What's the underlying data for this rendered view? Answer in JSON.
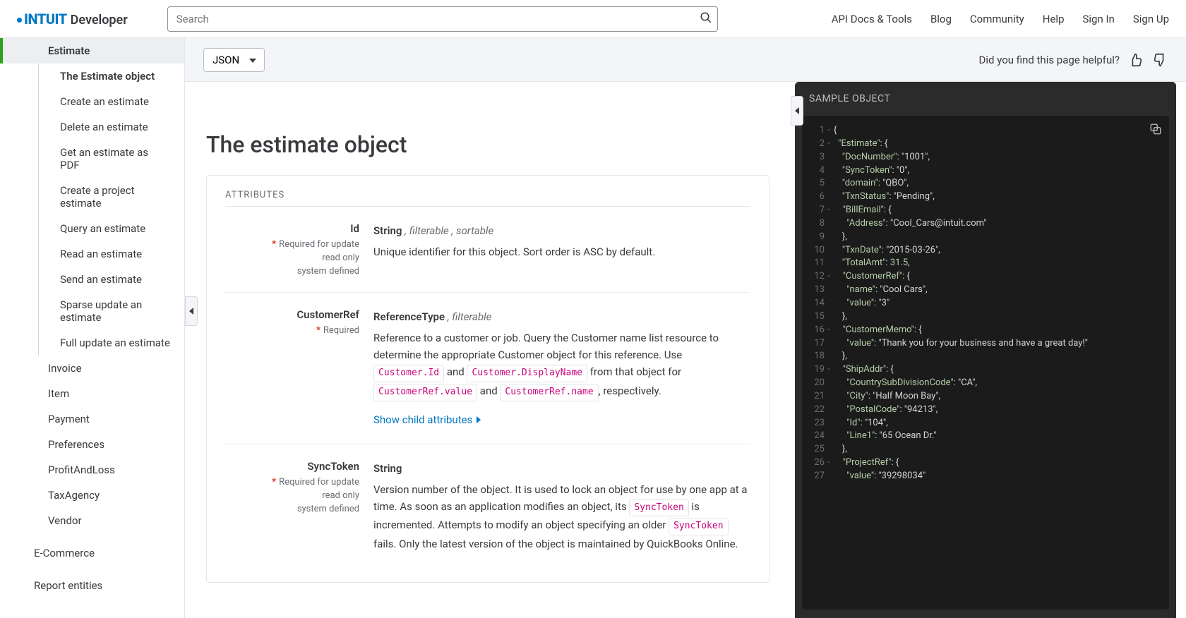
{
  "logo": {
    "brand": "INTUIT",
    "product": "Developer"
  },
  "search": {
    "placeholder": "Search"
  },
  "topnav": [
    "API Docs & Tools",
    "Blog",
    "Community",
    "Help",
    "Sign In",
    "Sign Up"
  ],
  "sidebar": {
    "parent": "Estimate",
    "children": [
      "The Estimate object",
      "Create an estimate",
      "Delete an estimate",
      "Get an estimate as PDF",
      "Create a project estimate",
      "Query an estimate",
      "Read an estimate",
      "Send an estimate",
      "Sparse update an estimate",
      "Full update an estimate"
    ],
    "rest": [
      "Invoice",
      "Item",
      "Payment",
      "Preferences",
      "ProfitAndLoss",
      "TaxAgency",
      "Vendor"
    ],
    "groups": [
      "E-Commerce",
      "Report entities"
    ]
  },
  "toolbar": {
    "format": "JSON",
    "helpful": "Did you find this page helpful?"
  },
  "page": {
    "title": "The estimate object",
    "attrHeader": "ATTRIBUTES"
  },
  "attrs": [
    {
      "name": "Id",
      "type": "String",
      "mods": ", filterable , sortable",
      "req": "Required for update",
      "meta1": "read only",
      "meta2": "system defined",
      "desc": "Unique identifier for this object. Sort order is ASC by default."
    },
    {
      "name": "CustomerRef",
      "type": "ReferenceType",
      "mods": ", filterable",
      "req": "Required",
      "meta1": "",
      "meta2": "",
      "desc_a": "Reference to a customer or job. Query the Customer name list resource to determine the appropriate Customer object for this reference. Use ",
      "pill1": "Customer.Id",
      "join1": " and ",
      "pill2": "Customer.DisplayName",
      "desc_b": " from that object for ",
      "pill3": "CustomerRef.value",
      "join2": " and ",
      "pill4": "CustomerRef.name",
      "desc_c": ", respectively.",
      "show": "Show child attributes"
    },
    {
      "name": "SyncToken",
      "type": "String",
      "mods": "",
      "req": "Required for update",
      "meta1": "read only",
      "meta2": "system defined",
      "desc_a": "Version number of the object. It is used to lock an object for use by one app at a time. As soon as an application modifies an object, its ",
      "pill1": "SyncToken",
      "desc_b": " is incremented. Attempts to modify an object specifying an older ",
      "pill2": "SyncToken",
      "desc_c": " fails. Only the latest version of the object is maintained by QuickBooks Online."
    }
  ],
  "sample": {
    "title": "SAMPLE OBJECT"
  },
  "code": [
    {
      "n": 1,
      "fold": "-",
      "txt": [
        [
          "pun",
          "{"
        ]
      ]
    },
    {
      "n": 2,
      "fold": "-",
      "txt": [
        [
          "pun",
          "  "
        ],
        [
          "key",
          "\"Estimate\""
        ],
        [
          "pun",
          ": {"
        ]
      ]
    },
    {
      "n": 3,
      "txt": [
        [
          "pun",
          "    "
        ],
        [
          "key",
          "\"DocNumber\""
        ],
        [
          "pun",
          ": "
        ],
        [
          "str",
          "\"1001\""
        ],
        [
          "pun",
          ","
        ]
      ]
    },
    {
      "n": 4,
      "txt": [
        [
          "pun",
          "    "
        ],
        [
          "key",
          "\"SyncToken\""
        ],
        [
          "pun",
          ": "
        ],
        [
          "str",
          "\"0\""
        ],
        [
          "pun",
          ","
        ]
      ]
    },
    {
      "n": 5,
      "txt": [
        [
          "pun",
          "    "
        ],
        [
          "key",
          "\"domain\""
        ],
        [
          "pun",
          ": "
        ],
        [
          "str",
          "\"QBO\""
        ],
        [
          "pun",
          ","
        ]
      ]
    },
    {
      "n": 6,
      "txt": [
        [
          "pun",
          "    "
        ],
        [
          "key",
          "\"TxnStatus\""
        ],
        [
          "pun",
          ": "
        ],
        [
          "str",
          "\"Pending\""
        ],
        [
          "pun",
          ","
        ]
      ]
    },
    {
      "n": 7,
      "fold": "-",
      "txt": [
        [
          "pun",
          "    "
        ],
        [
          "key",
          "\"BillEmail\""
        ],
        [
          "pun",
          ": {"
        ]
      ]
    },
    {
      "n": 8,
      "txt": [
        [
          "pun",
          "      "
        ],
        [
          "key",
          "\"Address\""
        ],
        [
          "pun",
          ": "
        ],
        [
          "str",
          "\"Cool_Cars@intuit.com\""
        ]
      ]
    },
    {
      "n": 9,
      "txt": [
        [
          "pun",
          "    },"
        ]
      ]
    },
    {
      "n": 10,
      "txt": [
        [
          "pun",
          "    "
        ],
        [
          "key",
          "\"TxnDate\""
        ],
        [
          "pun",
          ": "
        ],
        [
          "str",
          "\"2015-03-26\""
        ],
        [
          "pun",
          ","
        ]
      ]
    },
    {
      "n": 11,
      "txt": [
        [
          "pun",
          "    "
        ],
        [
          "key",
          "\"TotalAmt\""
        ],
        [
          "pun",
          ": "
        ],
        [
          "num",
          "31.5"
        ],
        [
          "pun",
          ","
        ]
      ]
    },
    {
      "n": 12,
      "fold": "-",
      "txt": [
        [
          "pun",
          "    "
        ],
        [
          "key",
          "\"CustomerRef\""
        ],
        [
          "pun",
          ": {"
        ]
      ]
    },
    {
      "n": 13,
      "txt": [
        [
          "pun",
          "      "
        ],
        [
          "key",
          "\"name\""
        ],
        [
          "pun",
          ": "
        ],
        [
          "str",
          "\"Cool Cars\""
        ],
        [
          "pun",
          ","
        ]
      ]
    },
    {
      "n": 14,
      "txt": [
        [
          "pun",
          "      "
        ],
        [
          "key",
          "\"value\""
        ],
        [
          "pun",
          ": "
        ],
        [
          "str",
          "\"3\""
        ]
      ]
    },
    {
      "n": 15,
      "txt": [
        [
          "pun",
          "    },"
        ]
      ]
    },
    {
      "n": 16,
      "fold": "-",
      "txt": [
        [
          "pun",
          "    "
        ],
        [
          "key",
          "\"CustomerMemo\""
        ],
        [
          "pun",
          ": {"
        ]
      ]
    },
    {
      "n": 17,
      "txt": [
        [
          "pun",
          "      "
        ],
        [
          "key",
          "\"value\""
        ],
        [
          "pun",
          ": "
        ],
        [
          "str",
          "\"Thank you for your business and have a great day!\""
        ]
      ]
    },
    {
      "n": 18,
      "txt": [
        [
          "pun",
          "    },"
        ]
      ]
    },
    {
      "n": 19,
      "fold": "-",
      "txt": [
        [
          "pun",
          "    "
        ],
        [
          "key",
          "\"ShipAddr\""
        ],
        [
          "pun",
          ": {"
        ]
      ]
    },
    {
      "n": 20,
      "txt": [
        [
          "pun",
          "      "
        ],
        [
          "key",
          "\"CountrySubDivisionCode\""
        ],
        [
          "pun",
          ": "
        ],
        [
          "str",
          "\"CA\""
        ],
        [
          "pun",
          ","
        ]
      ]
    },
    {
      "n": 21,
      "txt": [
        [
          "pun",
          "      "
        ],
        [
          "key",
          "\"City\""
        ],
        [
          "pun",
          ": "
        ],
        [
          "str",
          "\"Half Moon Bay\""
        ],
        [
          "pun",
          ","
        ]
      ]
    },
    {
      "n": 22,
      "txt": [
        [
          "pun",
          "      "
        ],
        [
          "key",
          "\"PostalCode\""
        ],
        [
          "pun",
          ": "
        ],
        [
          "str",
          "\"94213\""
        ],
        [
          "pun",
          ","
        ]
      ]
    },
    {
      "n": 23,
      "txt": [
        [
          "pun",
          "      "
        ],
        [
          "key",
          "\"Id\""
        ],
        [
          "pun",
          ": "
        ],
        [
          "str",
          "\"104\""
        ],
        [
          "pun",
          ","
        ]
      ]
    },
    {
      "n": 24,
      "txt": [
        [
          "pun",
          "      "
        ],
        [
          "key",
          "\"Line1\""
        ],
        [
          "pun",
          ": "
        ],
        [
          "str",
          "\"65 Ocean Dr.\""
        ]
      ]
    },
    {
      "n": 25,
      "txt": [
        [
          "pun",
          "    },"
        ]
      ]
    },
    {
      "n": 26,
      "fold": "-",
      "txt": [
        [
          "pun",
          "    "
        ],
        [
          "key",
          "\"ProjectRef\""
        ],
        [
          "pun",
          ": {"
        ]
      ]
    },
    {
      "n": 27,
      "txt": [
        [
          "pun",
          "      "
        ],
        [
          "key",
          "\"value\""
        ],
        [
          "pun",
          ": "
        ],
        [
          "str",
          "\"39298034\""
        ]
      ]
    }
  ]
}
